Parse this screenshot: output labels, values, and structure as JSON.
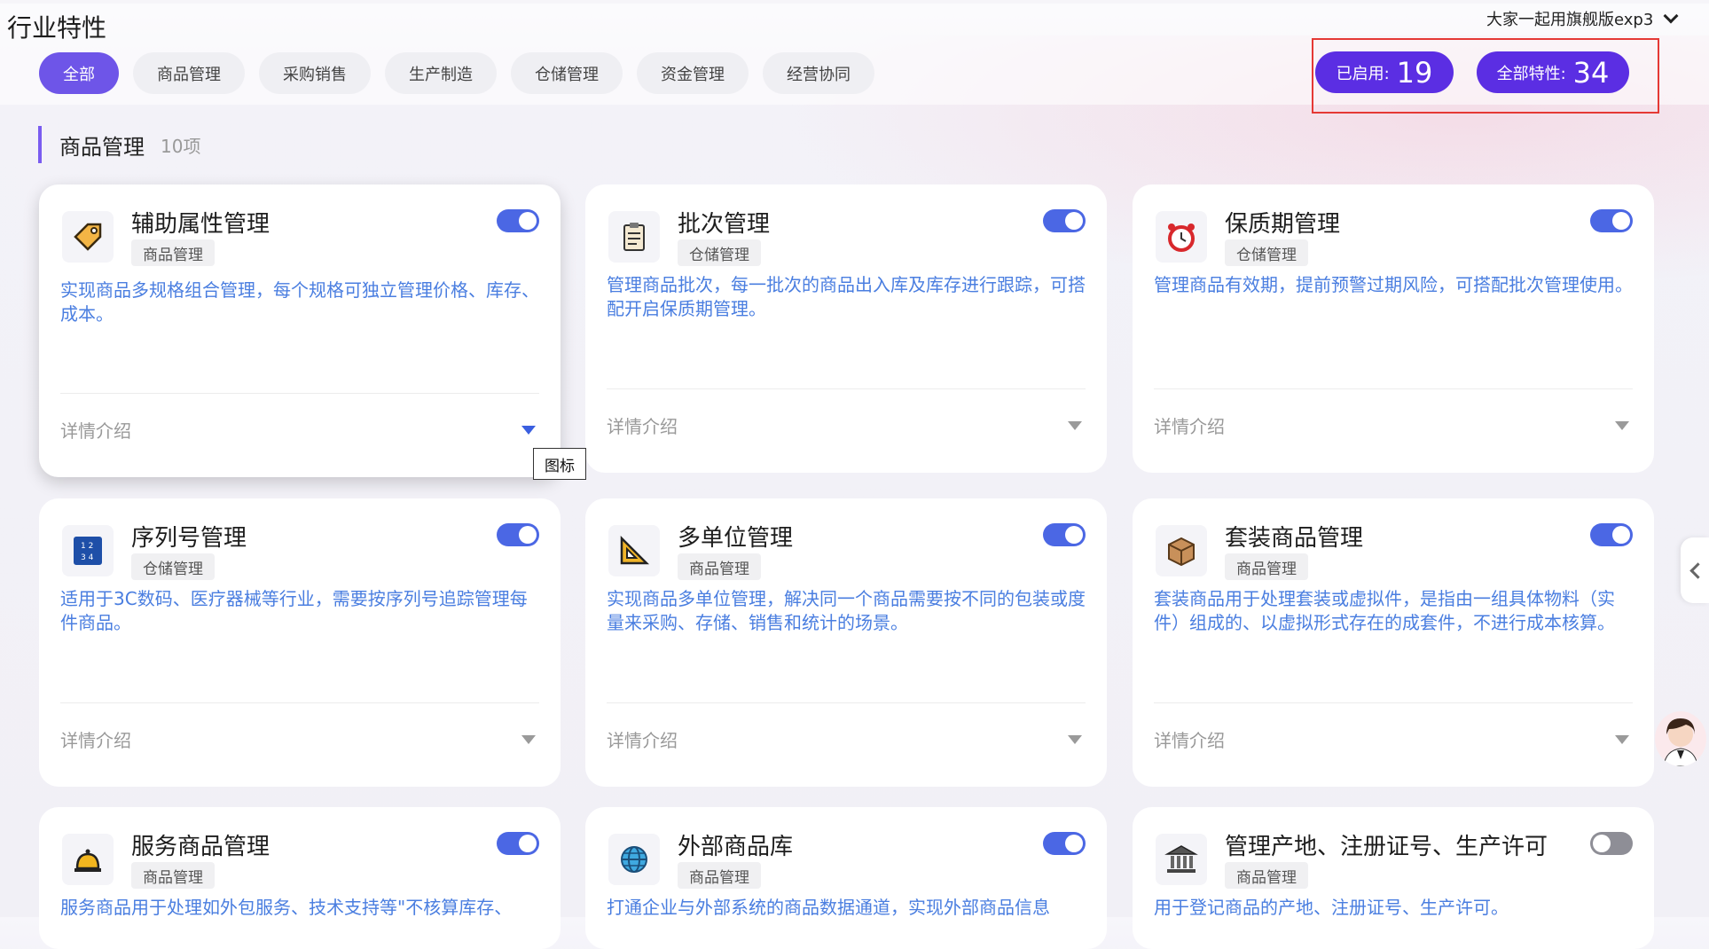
{
  "header": {
    "title": "行业特性",
    "version_label": "大家一起用旗舰版exp3"
  },
  "tabs": [
    {
      "label": "全部",
      "active": true
    },
    {
      "label": "商品管理"
    },
    {
      "label": "采购销售"
    },
    {
      "label": "生产制造"
    },
    {
      "label": "仓储管理"
    },
    {
      "label": "资金管理"
    },
    {
      "label": "经营协同"
    }
  ],
  "stats": {
    "enabled_label": "已启用:",
    "enabled_count": "19",
    "total_label": "全部特性:",
    "total_count": "34"
  },
  "section": {
    "title": "商品管理",
    "count": "10项"
  },
  "detail_label": "详情介绍",
  "tooltip": "图标",
  "cards": [
    {
      "title": "辅助属性管理",
      "tag": "商品管理",
      "enabled": true,
      "icon": "tag-icon",
      "desc": "实现商品多规格组合管理，每个规格可独立管理价格、库存、成本。"
    },
    {
      "title": "批次管理",
      "tag": "仓储管理",
      "enabled": true,
      "icon": "clipboard-icon",
      "desc": "管理商品批次，每一批次的商品出入库及库存进行跟踪，可搭配开启保质期管理。"
    },
    {
      "title": "保质期管理",
      "tag": "仓储管理",
      "enabled": true,
      "icon": "alarm-clock-icon",
      "desc": "管理商品有效期，提前预警过期风险，可搭配批次管理使用。"
    },
    {
      "title": "序列号管理",
      "tag": "仓储管理",
      "enabled": true,
      "icon": "number-grid-icon",
      "desc": "适用于3C数码、医疗器械等行业，需要按序列号追踪管理每件商品。"
    },
    {
      "title": "多单位管理",
      "tag": "商品管理",
      "enabled": true,
      "icon": "triangle-ruler-icon",
      "desc": "实现商品多单位管理，解决同一个商品需要按不同的包装或度量来采购、存储、销售和统计的场景。"
    },
    {
      "title": "套装商品管理",
      "tag": "商品管理",
      "enabled": true,
      "icon": "package-box-icon",
      "desc": "套装商品用于处理套装或虚拟件，是指由一组具体物料（实件）组成的、以虚拟形式存在的成套件，不进行成本核算。"
    },
    {
      "title": "服务商品管理",
      "tag": "商品管理",
      "enabled": true,
      "icon": "service-bell-icon",
      "desc": "服务商品用于处理如外包服务、技术支持等\"不核算库存、"
    },
    {
      "title": "外部商品库",
      "tag": "商品管理",
      "enabled": true,
      "icon": "globe-icon",
      "desc": "打通企业与外部系统的商品数据通道，实现外部商品信息"
    },
    {
      "title": "管理产地、注册证号、生产许可",
      "tag": "商品管理",
      "enabled": false,
      "icon": "bank-building-icon",
      "desc": "用于登记商品的产地、注册证号、生产许可。"
    }
  ]
}
